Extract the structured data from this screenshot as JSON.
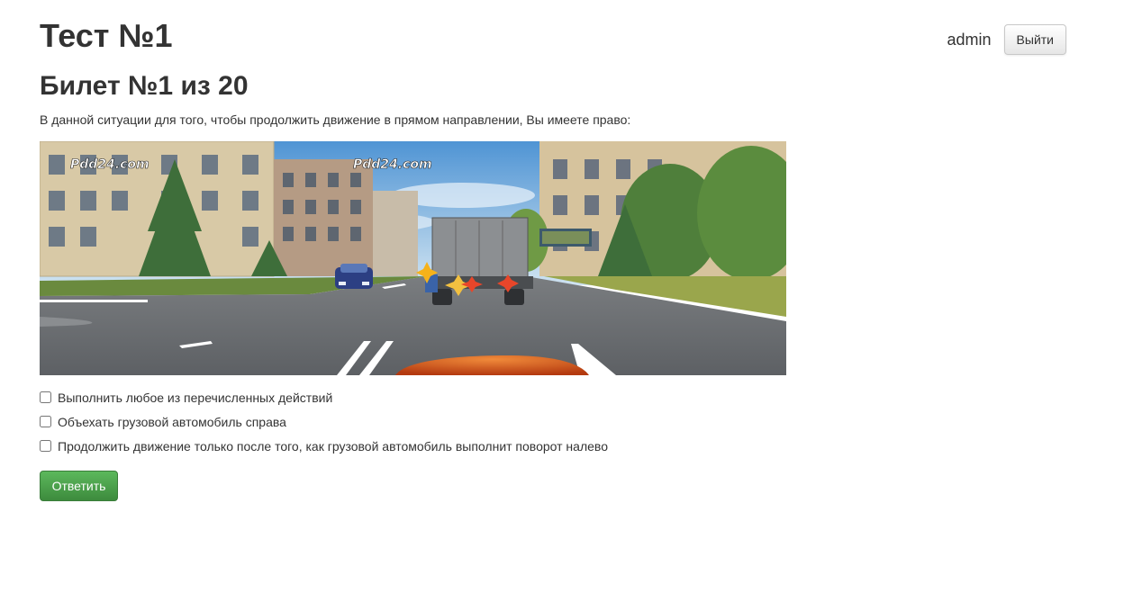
{
  "header": {
    "title": "Тест №1",
    "username": "admin",
    "logout_label": "Выйти"
  },
  "ticket": {
    "title": "Билет №1 из 20",
    "question": "В данной ситуации для того, чтобы продолжить движение в прямом направлении, Вы имеете право:",
    "image_watermark_left": "Pdd24.com",
    "image_watermark_center": "Pdd24.com"
  },
  "answers": [
    {
      "label": "Выполнить любое из перечисленных действий",
      "checked": false
    },
    {
      "label": "Объехать грузовой автомобиль справа",
      "checked": false
    },
    {
      "label": "Продолжить движение только после того, как грузовой автомобиль выполнит поворот налево",
      "checked": false
    }
  ],
  "submit_label": "Ответить",
  "colors": {
    "submit_button": "#449d44",
    "text": "#333333"
  }
}
